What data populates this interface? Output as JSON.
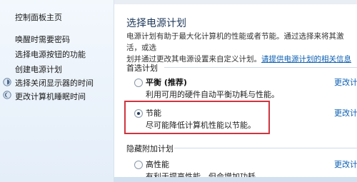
{
  "sidebar": {
    "home": "控制面板主页",
    "links": [
      {
        "label": "唤醒时需要密码",
        "icon": ""
      },
      {
        "label": "选择电源按钮的功能",
        "icon": ""
      },
      {
        "label": "创建电源计划",
        "icon": ""
      },
      {
        "label": "选择关闭显示器的时间",
        "icon": "monitor-icon"
      },
      {
        "label": "更改计算机睡眠时间",
        "icon": "moon-icon"
      }
    ]
  },
  "main": {
    "title": "选择电源计划",
    "desc_line1": "电源计划有助于最大化计算机的性能或者节能。通过选择来将其激活，或选",
    "desc_line2_prefix": "划并通过更改其电源设置来自定义计划。",
    "desc_link": "请提供电源计划的相关信息",
    "preferred_label": "首选计划",
    "hidden_label": "隐藏附加计划",
    "change_link": "更改计",
    "plans": [
      {
        "name": "平衡",
        "tag": " (推荐)",
        "desc": "利用可用的硬件自动平衡功耗与性能。",
        "selected": false
      },
      {
        "name": "节能",
        "tag": "",
        "desc": "尽可能降低计算机性能以节能。",
        "selected": true
      },
      {
        "name": "高性能",
        "tag": "",
        "desc": "有利于提高性能，但会增加功耗。",
        "selected": false
      }
    ]
  }
}
